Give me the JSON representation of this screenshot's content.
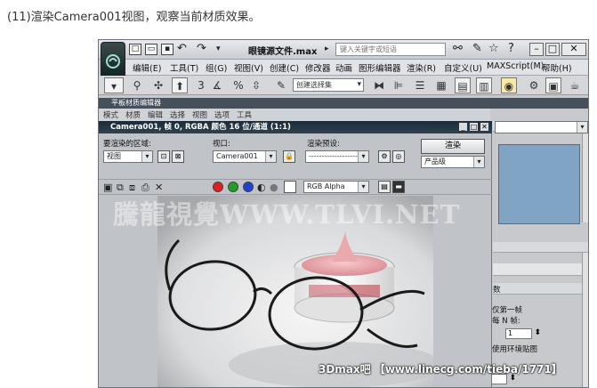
{
  "caption": "(11)渲染Camera001视图，观察当前材质效果。",
  "app": {
    "document_title": "眼镜源文件.max",
    "search_placeholder": "键入关键字或短语",
    "menu": [
      "编辑(E)",
      "工具(T)",
      "组(G)",
      "视图(V)",
      "创建(C)",
      "修改器",
      "动画",
      "图形编辑器",
      "渲染(R)",
      "自定义(U)",
      "MAXScript(M)",
      "帮助(H)"
    ],
    "selection_set_placeholder": "创建选择集"
  },
  "material_editor": {
    "title": "平板材质编辑器",
    "menu": [
      "模式",
      "材质",
      "编辑",
      "选择",
      "视图",
      "选项",
      "工具"
    ]
  },
  "render_frame": {
    "title": "Camera001, 帧 0, RGBA 颜色 16 位/通道 (1:1)",
    "area_label": "要渲染的区域:",
    "area_value": "视图",
    "viewport_label": "视口:",
    "viewport_value": "Camera001",
    "preset_label": "渲染预设:",
    "preset_value": "--------------------",
    "render_button": "渲染",
    "quality_value": "产品级",
    "channel_value": "RGB Alpha"
  },
  "side_panel": {
    "header": "数",
    "line1": "仅第一帧",
    "line2": "每 N 帧:",
    "n_value": "1",
    "line3": "使用环境贴图"
  },
  "watermarks": {
    "center": "騰龍視覺WWW.TLVI.NET",
    "bottom": "3Dmax吧 【www.linecg.com/tieba/1771】"
  },
  "colors": {
    "accent_titlebar": "#2f4250",
    "app_bg": "#c7c9cc"
  }
}
